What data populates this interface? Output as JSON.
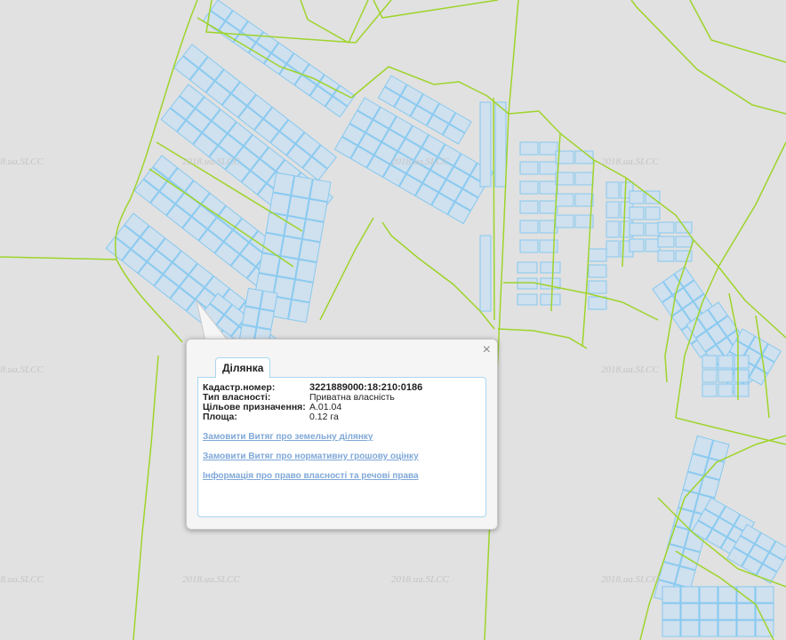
{
  "map": {
    "watermark_text": "2018.ua.SLCC",
    "colors": {
      "background": "#e1e1e1",
      "boundary_line": "#9ed42a",
      "parcel_fill": "#cfe0ee",
      "parcel_stroke": "#86c9f0"
    }
  },
  "popup": {
    "close_label": "×",
    "tab_label": "Ділянка",
    "fields": [
      {
        "label": "Кадастр.номер:",
        "value": "3221889000:18:210:0186"
      },
      {
        "label": "Тип власності:",
        "value": "Приватна власність"
      },
      {
        "label": "Цільове призначення:",
        "value": "А.01.04"
      },
      {
        "label": "Площа:",
        "value": "0.12 га"
      }
    ],
    "links": [
      "Замовити Витяг про земельну ділянку",
      "Замовити Витяг про нормативну грошову оцінку",
      "Інформація про право власності та речові права"
    ]
  }
}
